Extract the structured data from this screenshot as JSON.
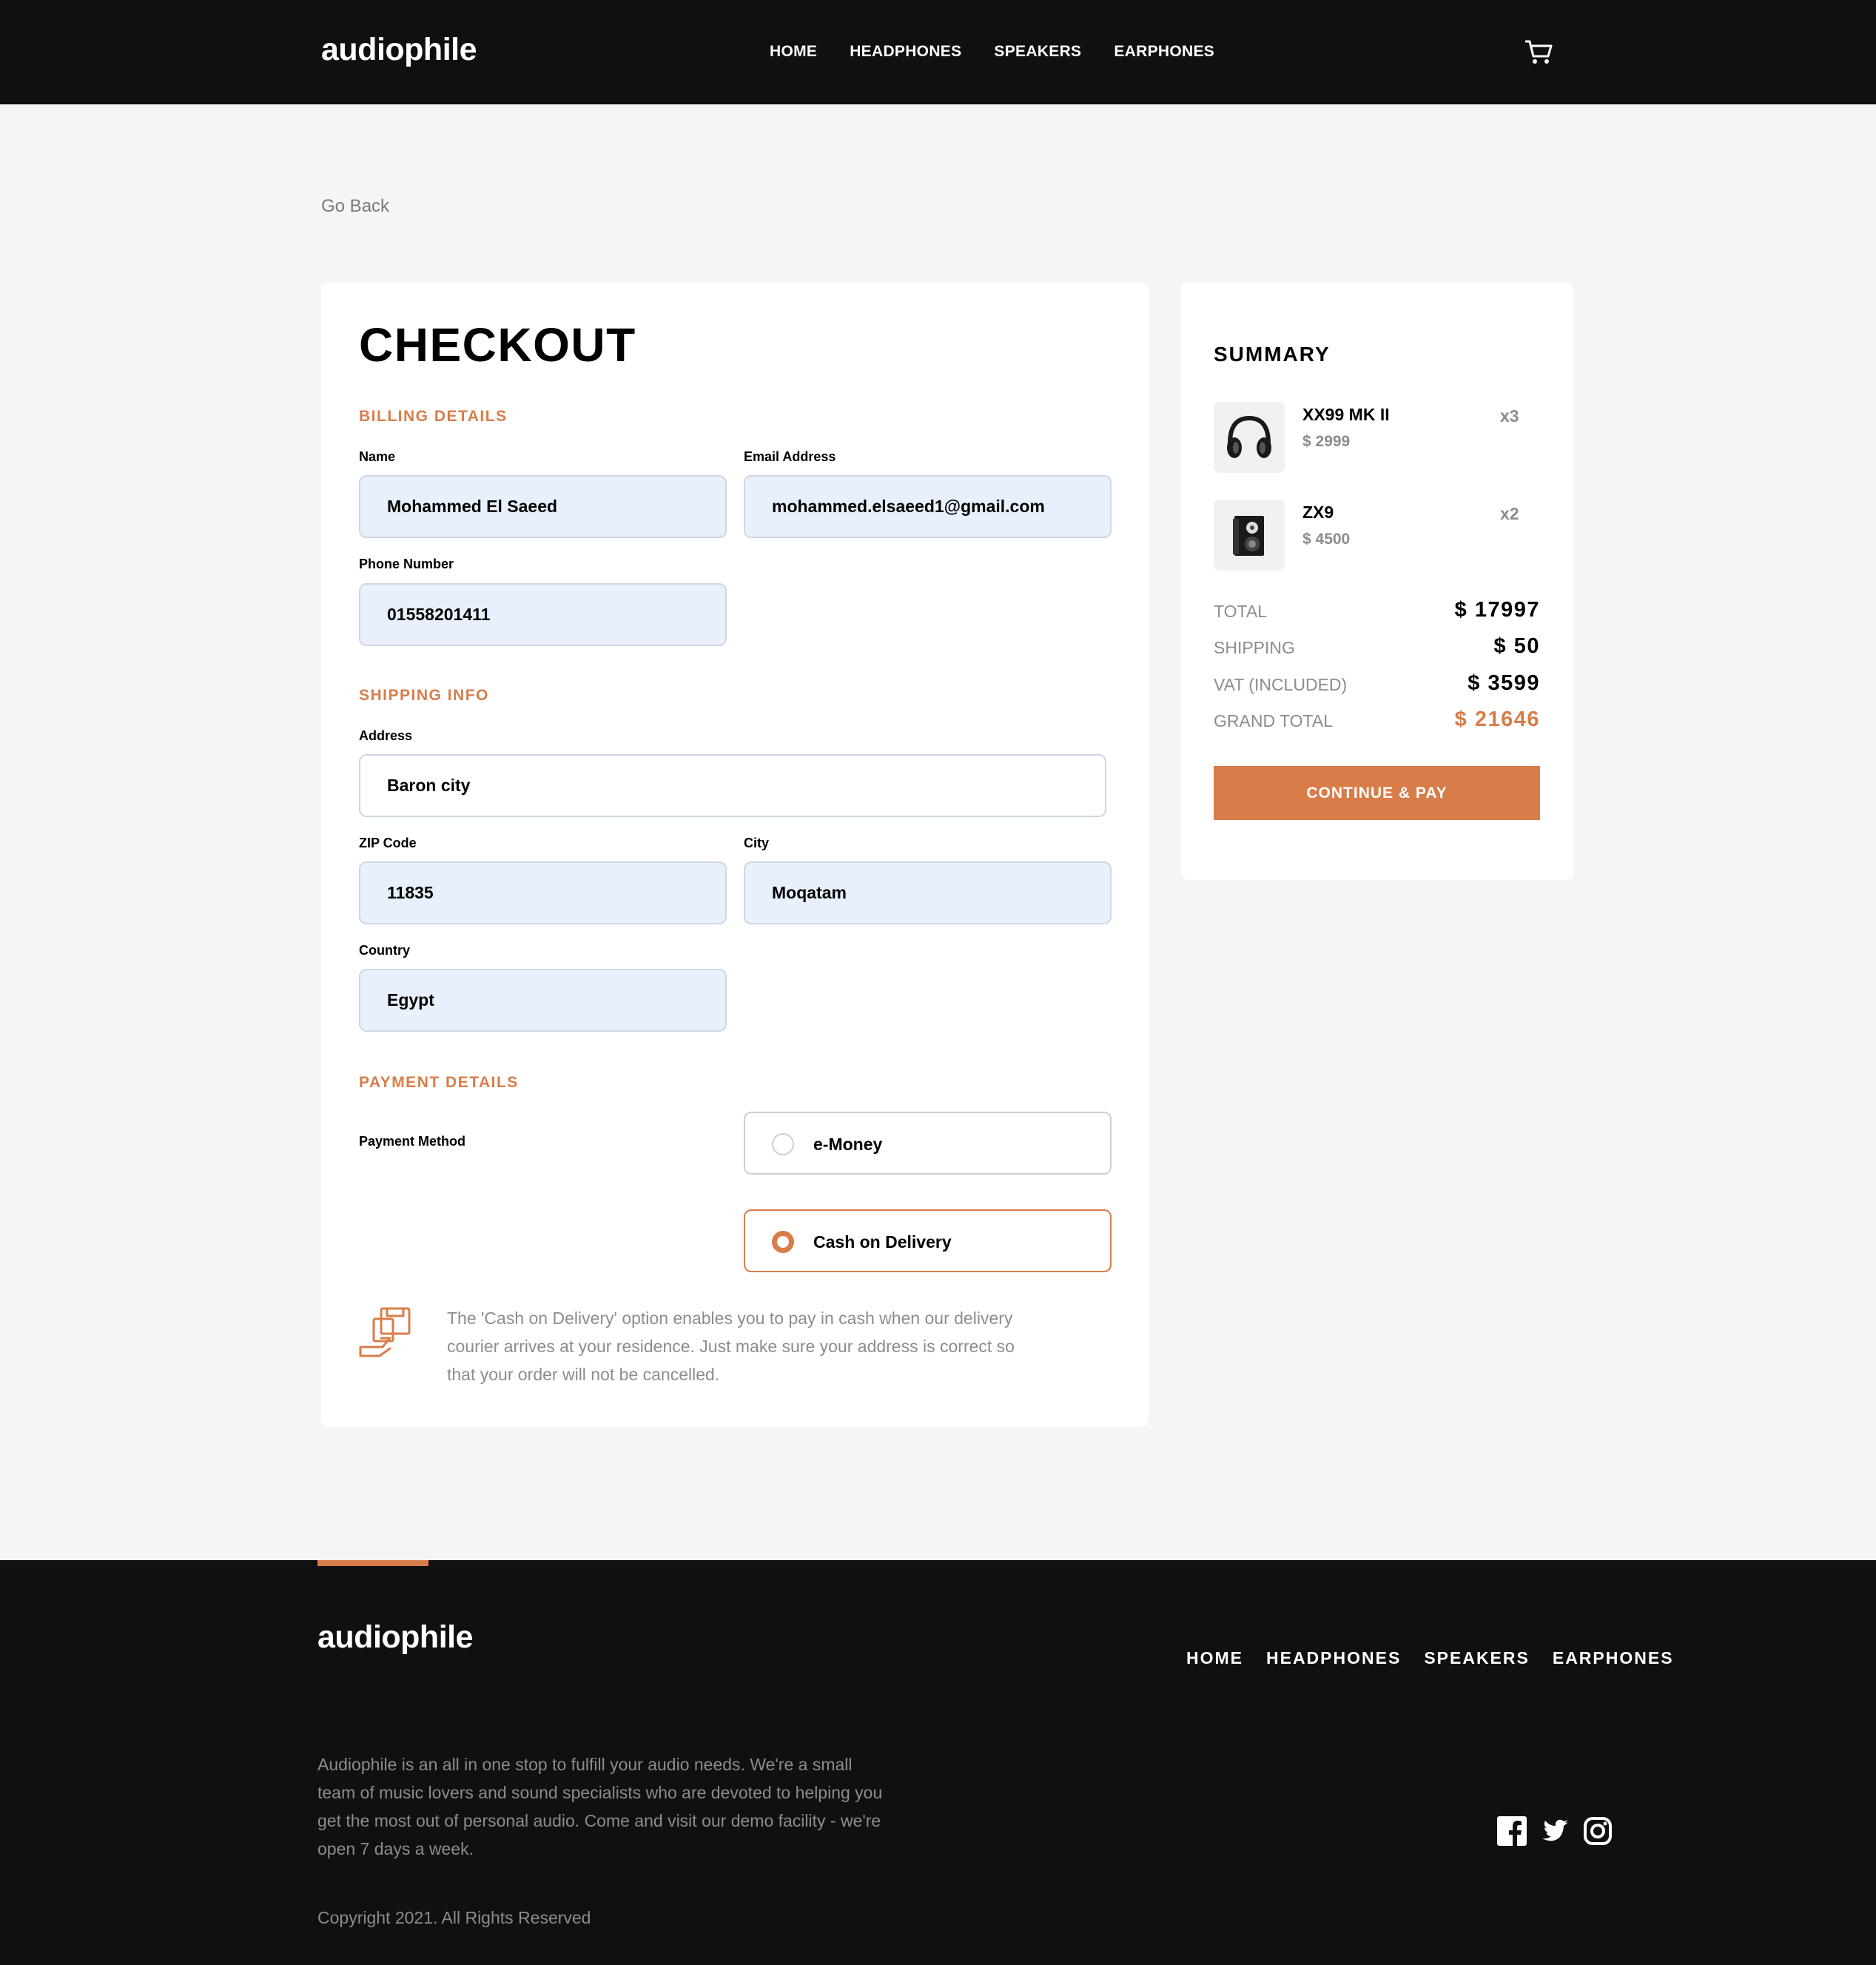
{
  "brand": "audiophile",
  "nav": [
    "HOME",
    "HEADPHONES",
    "SPEAKERS",
    "EARPHONES"
  ],
  "go_back": "Go Back",
  "checkout": {
    "title": "CHECKOUT",
    "billing": {
      "title": "BILLING DETAILS",
      "name_label": "Name",
      "name_value": "Mohammed El Saeed",
      "email_label": "Email Address",
      "email_value": "mohammed.elsaeed1@gmail.com",
      "phone_label": "Phone Number",
      "phone_value": "01558201411"
    },
    "shipping": {
      "title": "SHIPPING INFO",
      "address_label": "Address",
      "address_value": "Baron city",
      "zip_label": "ZIP Code",
      "zip_value": "11835",
      "city_label": "City",
      "city_value": "Moqatam",
      "country_label": "Country",
      "country_value": "Egypt"
    },
    "payment": {
      "title": "PAYMENT DETAILS",
      "method_label": "Payment Method",
      "options": [
        "e-Money",
        "Cash on Delivery"
      ],
      "selected": "Cash on Delivery",
      "cod_note": "The 'Cash on Delivery' option enables you to pay in cash when our delivery courier arrives at your residence. Just make sure your address is correct so that your order will not be cancelled."
    }
  },
  "summary": {
    "title": "SUMMARY",
    "items": [
      {
        "name": "XX99 MK II",
        "price": "$ 2999",
        "qty": "x3",
        "icon": "headphones-icon"
      },
      {
        "name": "ZX9",
        "price": "$ 4500",
        "qty": "x2",
        "icon": "speaker-icon"
      }
    ],
    "total_label": "TOTAL",
    "total_value": "$ 17997",
    "shipping_label": "SHIPPING",
    "shipping_value": "$ 50",
    "vat_label": "VAT (INCLUDED)",
    "vat_value": "$ 3599",
    "grand_total_label": "GRAND TOTAL",
    "grand_total_value": "$ 21646",
    "pay_button": "CONTINUE & PAY"
  },
  "footer": {
    "brand": "audiophile",
    "nav": [
      "HOME",
      "HEADPHONES",
      "SPEAKERS",
      "EARPHONES"
    ],
    "description": "Audiophile is an all in one stop to fulfill your audio needs. We're a small team of music lovers and sound specialists who are devoted to helping you get the most out of personal audio. Come and visit our demo facility - we're open 7 days a week.",
    "copyright": "Copyright 2021. All Rights Reserved",
    "social": [
      "facebook-icon",
      "twitter-icon",
      "instagram-icon"
    ]
  },
  "colors": {
    "accent": "#d87d4a",
    "dark": "#101010",
    "background": "#f5f5f5",
    "input_fill": "#e8f0fe"
  }
}
